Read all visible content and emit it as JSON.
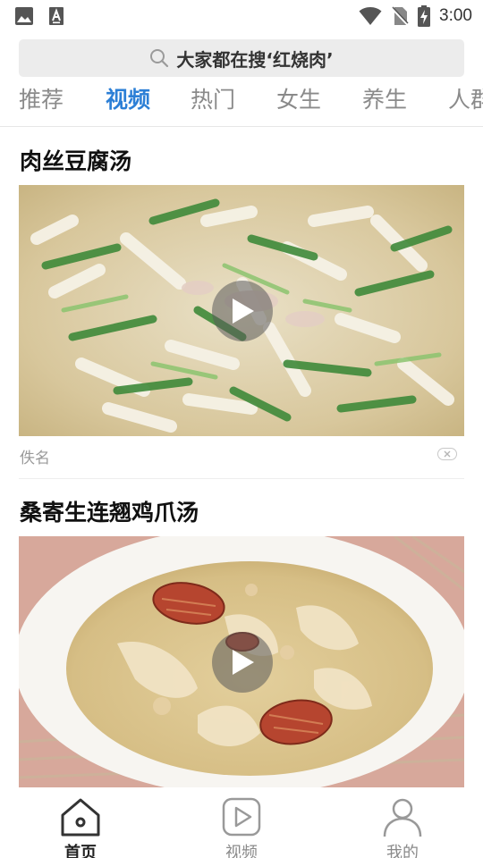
{
  "status_bar": {
    "time": "3:00",
    "left_icons": [
      "image-icon",
      "app-a-icon"
    ],
    "right_icons": [
      "wifi-icon",
      "no-sim-icon",
      "battery-charging-icon"
    ]
  },
  "search": {
    "text": "大家都在搜‘红烧肉’",
    "icon": "search-icon"
  },
  "tabs": [
    {
      "label": "推荐",
      "active": false
    },
    {
      "label": "视频",
      "active": true
    },
    {
      "label": "热门",
      "active": false
    },
    {
      "label": "女生",
      "active": false
    },
    {
      "label": "养生",
      "active": false
    },
    {
      "label": "人群",
      "active": false
    }
  ],
  "feed": {
    "items": [
      {
        "title": "肉丝豆腐汤",
        "source": "佚名",
        "has_video": true
      },
      {
        "title": "桑寄生连翘鸡爪汤",
        "has_video": true
      }
    ]
  },
  "bottom_nav": [
    {
      "label": "首页",
      "icon": "home-icon",
      "active": true
    },
    {
      "label": "视频",
      "icon": "video-play-icon",
      "active": false
    },
    {
      "label": "我的",
      "icon": "user-icon",
      "active": false
    }
  ],
  "colors": {
    "accent": "#2c7fd6",
    "inactive": "#8a8a8a",
    "search_bg": "#ececec"
  }
}
